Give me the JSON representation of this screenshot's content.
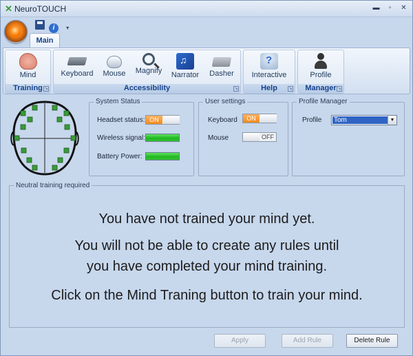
{
  "window": {
    "title": "NeuroTOUCH",
    "icon": "x-icon",
    "minimize": "▬",
    "restore": "▫",
    "close": "✕"
  },
  "qat": {
    "save_icon": "save-icon",
    "info_icon": "info-icon",
    "info_glyph": "i",
    "drop_glyph": "▾"
  },
  "ribbon": {
    "tab": "Main",
    "groups": [
      {
        "label": "Training",
        "buttons": [
          {
            "label": "Mind",
            "icon": "brain-icon"
          }
        ]
      },
      {
        "label": "Accessibility",
        "buttons": [
          {
            "label": "Keyboard",
            "icon": "keyboard-icon"
          },
          {
            "label": "Mouse",
            "icon": "mouse-icon"
          },
          {
            "label": "Magnify",
            "icon": "magnify-icon"
          },
          {
            "label": "Narrator",
            "icon": "narrator-icon"
          },
          {
            "label": "Dasher",
            "icon": "dasher-icon"
          }
        ]
      },
      {
        "label": "Help",
        "buttons": [
          {
            "label": "Interactive",
            "icon": "interactive-help-icon"
          }
        ]
      },
      {
        "label": "Manager",
        "buttons": [
          {
            "label": "Profile",
            "icon": "profile-icon"
          }
        ]
      }
    ],
    "launcher_glyph": "↘"
  },
  "system_status": {
    "title": "System Status",
    "headset_label": "Headset status:",
    "headset_toggle": "ON",
    "wireless_label": "Wireless signal:",
    "battery_label": "Battery Power:",
    "wireless_level": 1.0,
    "battery_level": 1.0,
    "level_color": "#22b522"
  },
  "user_settings": {
    "title": "User settings",
    "keyboard_label": "Keyboard",
    "keyboard_toggle": "ON",
    "mouse_label": "Mouse",
    "mouse_toggle": "OFF"
  },
  "profile_manager": {
    "title": "Profile Manager",
    "profile_label": "Profile",
    "profile_value": "Tom",
    "dropdown_glyph": "▼"
  },
  "training": {
    "title": "Neutral training required",
    "line1": "You have not trained your mind yet.",
    "line2": "You will not be able to create any rules until",
    "line3": "you have completed your mind training.",
    "line4": "Click on the Mind Traning button to train your mind."
  },
  "actions": {
    "apply": "Apply",
    "add_rule": "Add Rule",
    "delete_rule": "Delete Rule"
  },
  "colors": {
    "accent": "#f28a1d",
    "ribbon_text": "#15428b",
    "sensor": "#3a9a3a"
  }
}
